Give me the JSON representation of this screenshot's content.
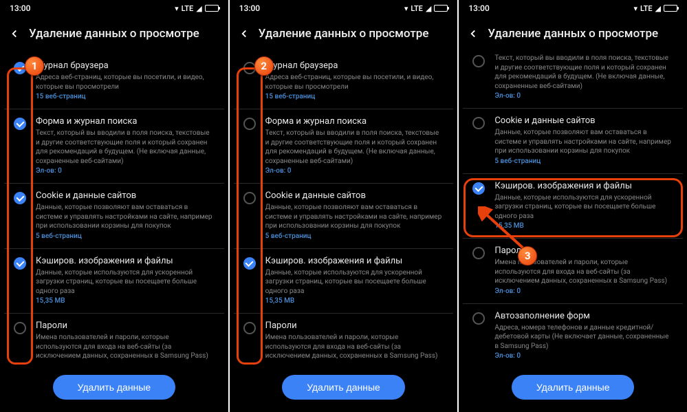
{
  "status": {
    "time": "13:00",
    "network": "LTE"
  },
  "header": {
    "title": "Удаление данных о просмотре"
  },
  "screen1": {
    "items": [
      {
        "title": "Журнал браузера",
        "desc": "Адреса веб-страниц, которые вы посетили, и видео, которые вы просмотрели",
        "info": "15 веб-страниц",
        "checked": true
      },
      {
        "title": "Форма и журнал поиска",
        "desc": "Текст, который вы вводили в поля поиска, текстовые и другие соответствующие поля и который сохранен для рекомендаций в будущем. (Не включая данные, сохраненные веб-сайтами)",
        "info": "Эл-ов: 0",
        "checked": true
      },
      {
        "title": "Cookie и данные сайтов",
        "desc": "Данные, которые позволяют вам оставаться в системе и управлять настройками на сайте, например при использовании корзины для покупок",
        "info": "5 веб-страниц",
        "checked": true
      },
      {
        "title": "Кэширов. изображения и файлы",
        "desc": "Данные, которые используются для ускоренной загрузки страниц, которые вы посещаете больше одного раза",
        "info": "15,35 МВ",
        "checked": true
      },
      {
        "title": "Пароли",
        "desc": "Имена пользователей и пароли, которые используются для входа на веб-сайты (за исключением данных, сохраненных в Samsung Pass)",
        "info": "",
        "checked": false
      }
    ]
  },
  "screen2": {
    "items": [
      {
        "title": "Журнал браузера",
        "desc": "Адреса веб-страниц, которые вы посетили, и видео, которые вы просмотрели",
        "info": "15 веб-страниц",
        "checked": false
      },
      {
        "title": "Форма и журнал поиска",
        "desc": "Текст, который вы вводили в поля поиска, текстовые и другие соответствующие поля и который сохранен для рекомендаций в будущем. (Не включая данные, сохраненные веб-сайтами)",
        "info": "Эл-ов: 0",
        "checked": false
      },
      {
        "title": "Cookie и данные сайтов",
        "desc": "Данные, которые позволяют вам оставаться в системе и управлять настройками на сайте, например при использовании корзины для покупок",
        "info": "5 веб-страниц",
        "checked": false
      },
      {
        "title": "Кэширов. изображения и файлы",
        "desc": "Данные, которые используются для ускоренной загрузки страниц, которые вы посещаете больше одного раза",
        "info": "15,35 МВ",
        "checked": true
      },
      {
        "title": "Пароли",
        "desc": "Имена пользователей и пароли, которые используются для входа на веб-сайты (за исключением данных, сохраненных в Samsung Pass)",
        "info": "",
        "checked": false
      }
    ]
  },
  "screen3": {
    "items": [
      {
        "title": "",
        "desc": "Текст, который вы вводили в поля поиска, текстовые и другие соответствующие поля и который сохранен для рекомендаций в будущем. (Не включая данные, сохраненные веб-сайтами)",
        "info": "Эл-ов: 0",
        "checked": false
      },
      {
        "title": "Cookie и данные сайтов",
        "desc": "Данные, которые позволяют вам оставаться в системе и управлять настройками на сайте, например при использовании корзины для покупок",
        "info": "5 веб-страниц",
        "checked": false
      },
      {
        "title": "Кэширов. изображения и файлы",
        "desc": "Данные, которые используются для ускоренной загрузки страниц, которые вы посещаете больше одного раза",
        "info": "15,35 МВ",
        "checked": true
      },
      {
        "title": "Пароли",
        "desc": "Имена пользователей и пароли, которые используются для входа на веб-сайты (за исключением данных, сохраненных в Samsung Pass)",
        "info": "Эл-ов: 0",
        "checked": false
      },
      {
        "title": "Автозаполнение форм",
        "desc": "Адреса, номера телефонов и данные кредитной/дебетовой карты (Не включает данные, сохраненные в Samsung Pass)",
        "info": "Эл-ов: 0",
        "checked": false
      }
    ]
  },
  "button": {
    "label": "Удалить данные"
  },
  "callouts": {
    "n1": "1",
    "n2": "2",
    "n3": "3"
  }
}
